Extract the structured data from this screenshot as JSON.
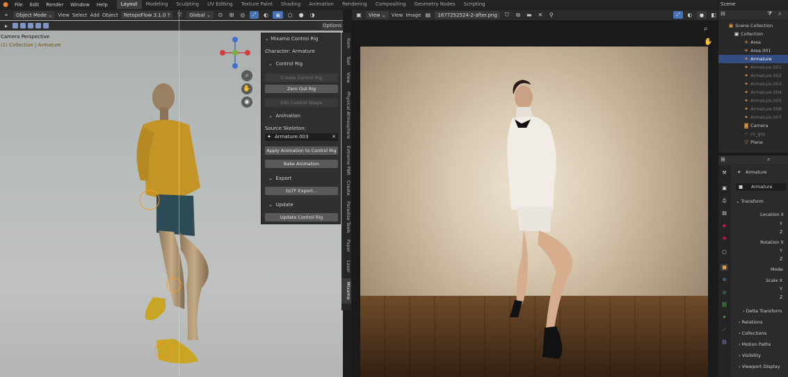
{
  "topbar": {
    "menus": [
      "File",
      "Edit",
      "Render",
      "Window",
      "Help"
    ],
    "workspaces": [
      "Layout",
      "Modeling",
      "Sculpting",
      "UV Editing",
      "Texture Paint",
      "Shading",
      "Animation",
      "Rendering",
      "Compositing",
      "Geometry Nodes",
      "Scripting"
    ],
    "active_workspace": "Layout",
    "scene_label": "Scene"
  },
  "viewport": {
    "mode": "Object Mode",
    "menu": [
      "View",
      "Select",
      "Add",
      "Object"
    ],
    "addon": "RetopoFlow 3.1.0",
    "transform": "Global",
    "options": "Options",
    "camera_label": "Camera Perspective",
    "collection_label": "(1) Collection | Armature"
  },
  "npanel": {
    "title": "Mixamo Control Rig",
    "character": "Character: Armature",
    "control_rig": "Control Rig",
    "create_control_rig": "Create Control Rig",
    "zero_out_rig": "Zero Out Rig",
    "edit_control_shape": "Edit Control Shape",
    "animation": "Animation",
    "source_skeleton": "Source Skeleton:",
    "source_value": "Armature.003",
    "apply_animation": "Apply Animation to Control Rig",
    "bake_animation": "Bake Animation",
    "export": "Export",
    "gltf_export": "GLTF Export...",
    "update": "Update",
    "update_control_rig": "Update Control Rig"
  },
  "vtabs": [
    "Item",
    "Tool",
    "View",
    "Physical Atmosphere",
    "Extreme PBR",
    "Create",
    "Paradise Tools",
    "Paper",
    "Laser",
    "Mixamo"
  ],
  "image_editor": {
    "menu": [
      "View",
      "View",
      "Image"
    ],
    "filename": "1677252524-2-after.png"
  },
  "outliner": {
    "items": [
      {
        "label": "Scene Collection",
        "icon": "scene-collection-icon"
      },
      {
        "label": "Collection",
        "icon": "collection-icon"
      },
      {
        "label": "Area",
        "icon": "light-icon"
      },
      {
        "label": "Area.001",
        "icon": "light-icon"
      },
      {
        "label": "Armature",
        "icon": "armature-icon"
      },
      {
        "label": "Armature.001",
        "icon": "armature-icon"
      },
      {
        "label": "Armature.002",
        "icon": "armature-icon"
      },
      {
        "label": "Armature.003",
        "icon": "armature-icon"
      },
      {
        "label": "Armature.004",
        "icon": "armature-icon"
      },
      {
        "label": "Armature.005",
        "icon": "armature-icon"
      },
      {
        "label": "Armature.006",
        "icon": "armature-icon"
      },
      {
        "label": "Armature.007",
        "icon": "armature-icon"
      },
      {
        "label": "Camera",
        "icon": "camera-icon"
      },
      {
        "label": "cs_grp",
        "icon": "empty-icon"
      },
      {
        "label": "Plane",
        "icon": "mesh-icon"
      }
    ],
    "selected_index": 4
  },
  "properties": {
    "object_name": "Armature",
    "object_field": "Armature",
    "transform": "Transform",
    "location_x": "Location X",
    "y": "Y",
    "z": "Z",
    "rotation_x": "Rotation X",
    "mode": "Mode",
    "scale_x": "Scale X",
    "delta_transform": "Delta Transform",
    "relations": "Relations",
    "collections": "Collections",
    "motion_paths": "Motion Paths",
    "visibility": "Visibility",
    "viewport_display": "Viewport Display"
  },
  "colors": {
    "accent_blue": "#4772b3",
    "selected_row": "#334d80",
    "panel_bg": "#282828",
    "axis_x": "#d13d3d",
    "axis_y": "#74b340",
    "axis_z": "#3f6fcf"
  }
}
